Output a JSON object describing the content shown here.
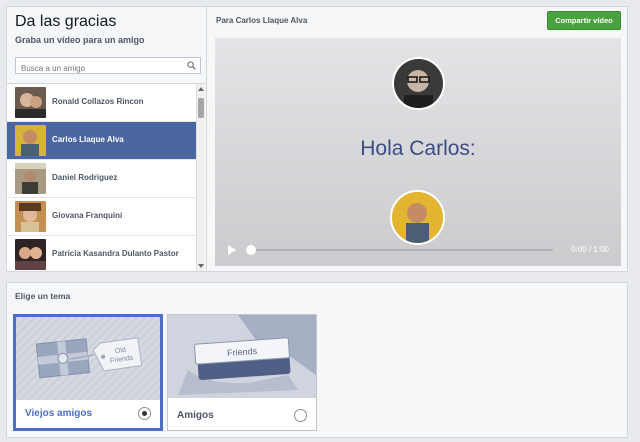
{
  "header": {
    "title": "Da las gracias",
    "subtitle": "Graba un vídeo para un amigo"
  },
  "search": {
    "placeholder": "Busca a un amigo",
    "icon": "search-icon"
  },
  "friends": [
    {
      "name": "Ronald Collazos Rincon",
      "selected": false
    },
    {
      "name": "Carlos Llaque Alva",
      "selected": true
    },
    {
      "name": "Daniel Rodriguez",
      "selected": false
    },
    {
      "name": "Giovana Franquini",
      "selected": false
    },
    {
      "name": "Patricia Kasandra Dulanto Pastor",
      "selected": false
    }
  ],
  "preview": {
    "for_label": "Para Carlos Llaque Alva",
    "share_button": "Compartir vídeo",
    "greeting": "Hola Carlos:",
    "time": "0:00 / 1:00",
    "progress": 0
  },
  "themes": {
    "title": "Elige un tema",
    "options": [
      {
        "label": "Viejos amigos",
        "art_text": [
          "Old",
          "Friends"
        ],
        "selected": true
      },
      {
        "label": "Amigos",
        "art_text": [
          "Friends"
        ],
        "selected": false
      }
    ]
  },
  "colors": {
    "selected_row": "#4b67a1",
    "share_button": "#4aa23e",
    "greeting_text": "#3b4d83",
    "selected_theme": "#4b6fc4"
  }
}
